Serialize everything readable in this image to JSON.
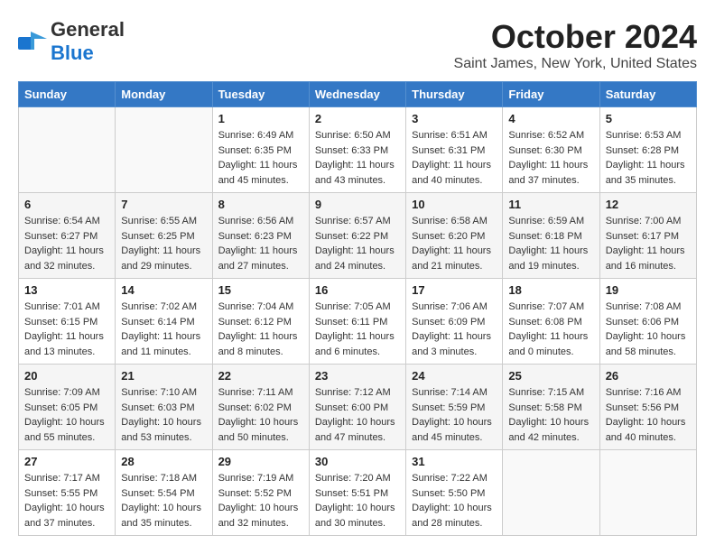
{
  "header": {
    "logo_general": "General",
    "logo_blue": "Blue",
    "title": "October 2024",
    "subtitle": "Saint James, New York, United States"
  },
  "days_of_week": [
    "Sunday",
    "Monday",
    "Tuesday",
    "Wednesday",
    "Thursday",
    "Friday",
    "Saturday"
  ],
  "weeks": [
    [
      {
        "num": "",
        "info": ""
      },
      {
        "num": "",
        "info": ""
      },
      {
        "num": "1",
        "info": "Sunrise: 6:49 AM\nSunset: 6:35 PM\nDaylight: 11 hours and 45 minutes."
      },
      {
        "num": "2",
        "info": "Sunrise: 6:50 AM\nSunset: 6:33 PM\nDaylight: 11 hours and 43 minutes."
      },
      {
        "num": "3",
        "info": "Sunrise: 6:51 AM\nSunset: 6:31 PM\nDaylight: 11 hours and 40 minutes."
      },
      {
        "num": "4",
        "info": "Sunrise: 6:52 AM\nSunset: 6:30 PM\nDaylight: 11 hours and 37 minutes."
      },
      {
        "num": "5",
        "info": "Sunrise: 6:53 AM\nSunset: 6:28 PM\nDaylight: 11 hours and 35 minutes."
      }
    ],
    [
      {
        "num": "6",
        "info": "Sunrise: 6:54 AM\nSunset: 6:27 PM\nDaylight: 11 hours and 32 minutes."
      },
      {
        "num": "7",
        "info": "Sunrise: 6:55 AM\nSunset: 6:25 PM\nDaylight: 11 hours and 29 minutes."
      },
      {
        "num": "8",
        "info": "Sunrise: 6:56 AM\nSunset: 6:23 PM\nDaylight: 11 hours and 27 minutes."
      },
      {
        "num": "9",
        "info": "Sunrise: 6:57 AM\nSunset: 6:22 PM\nDaylight: 11 hours and 24 minutes."
      },
      {
        "num": "10",
        "info": "Sunrise: 6:58 AM\nSunset: 6:20 PM\nDaylight: 11 hours and 21 minutes."
      },
      {
        "num": "11",
        "info": "Sunrise: 6:59 AM\nSunset: 6:18 PM\nDaylight: 11 hours and 19 minutes."
      },
      {
        "num": "12",
        "info": "Sunrise: 7:00 AM\nSunset: 6:17 PM\nDaylight: 11 hours and 16 minutes."
      }
    ],
    [
      {
        "num": "13",
        "info": "Sunrise: 7:01 AM\nSunset: 6:15 PM\nDaylight: 11 hours and 13 minutes."
      },
      {
        "num": "14",
        "info": "Sunrise: 7:02 AM\nSunset: 6:14 PM\nDaylight: 11 hours and 11 minutes."
      },
      {
        "num": "15",
        "info": "Sunrise: 7:04 AM\nSunset: 6:12 PM\nDaylight: 11 hours and 8 minutes."
      },
      {
        "num": "16",
        "info": "Sunrise: 7:05 AM\nSunset: 6:11 PM\nDaylight: 11 hours and 6 minutes."
      },
      {
        "num": "17",
        "info": "Sunrise: 7:06 AM\nSunset: 6:09 PM\nDaylight: 11 hours and 3 minutes."
      },
      {
        "num": "18",
        "info": "Sunrise: 7:07 AM\nSunset: 6:08 PM\nDaylight: 11 hours and 0 minutes."
      },
      {
        "num": "19",
        "info": "Sunrise: 7:08 AM\nSunset: 6:06 PM\nDaylight: 10 hours and 58 minutes."
      }
    ],
    [
      {
        "num": "20",
        "info": "Sunrise: 7:09 AM\nSunset: 6:05 PM\nDaylight: 10 hours and 55 minutes."
      },
      {
        "num": "21",
        "info": "Sunrise: 7:10 AM\nSunset: 6:03 PM\nDaylight: 10 hours and 53 minutes."
      },
      {
        "num": "22",
        "info": "Sunrise: 7:11 AM\nSunset: 6:02 PM\nDaylight: 10 hours and 50 minutes."
      },
      {
        "num": "23",
        "info": "Sunrise: 7:12 AM\nSunset: 6:00 PM\nDaylight: 10 hours and 47 minutes."
      },
      {
        "num": "24",
        "info": "Sunrise: 7:14 AM\nSunset: 5:59 PM\nDaylight: 10 hours and 45 minutes."
      },
      {
        "num": "25",
        "info": "Sunrise: 7:15 AM\nSunset: 5:58 PM\nDaylight: 10 hours and 42 minutes."
      },
      {
        "num": "26",
        "info": "Sunrise: 7:16 AM\nSunset: 5:56 PM\nDaylight: 10 hours and 40 minutes."
      }
    ],
    [
      {
        "num": "27",
        "info": "Sunrise: 7:17 AM\nSunset: 5:55 PM\nDaylight: 10 hours and 37 minutes."
      },
      {
        "num": "28",
        "info": "Sunrise: 7:18 AM\nSunset: 5:54 PM\nDaylight: 10 hours and 35 minutes."
      },
      {
        "num": "29",
        "info": "Sunrise: 7:19 AM\nSunset: 5:52 PM\nDaylight: 10 hours and 32 minutes."
      },
      {
        "num": "30",
        "info": "Sunrise: 7:20 AM\nSunset: 5:51 PM\nDaylight: 10 hours and 30 minutes."
      },
      {
        "num": "31",
        "info": "Sunrise: 7:22 AM\nSunset: 5:50 PM\nDaylight: 10 hours and 28 minutes."
      },
      {
        "num": "",
        "info": ""
      },
      {
        "num": "",
        "info": ""
      }
    ]
  ]
}
